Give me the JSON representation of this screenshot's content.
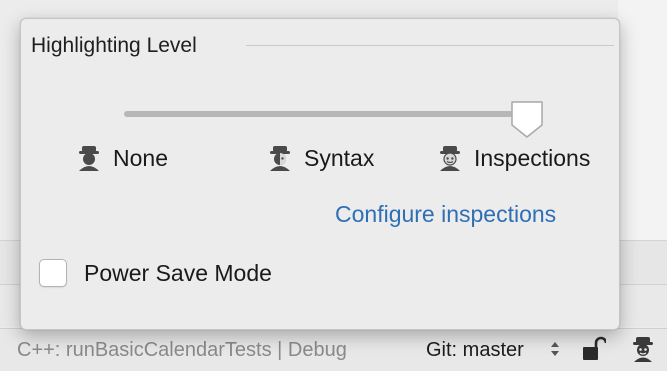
{
  "popup": {
    "section_title": "Highlighting Level",
    "slider": {
      "levels": 3,
      "selected_index": 2,
      "selected_level": "Inspections"
    },
    "levels": [
      {
        "label": "None",
        "icon": "inspector-none-icon"
      },
      {
        "label": "Syntax",
        "icon": "inspector-syntax-icon"
      },
      {
        "label": "Inspections",
        "icon": "inspector-full-icon"
      }
    ],
    "configure_link": "Configure inspections",
    "power_save": {
      "label": "Power Save Mode",
      "checked": false
    }
  },
  "status_bar": {
    "run_config": "C++: runBasicCalendarTests | Debug",
    "git_branch": "Git: master",
    "icons": [
      "git-branch-arrows-icon",
      "lock-icon",
      "inspector-icon"
    ]
  },
  "colors": {
    "link": "#2f6fb6",
    "popup_bg": "#ececec",
    "status_muted_text": "#8a8a8a"
  }
}
